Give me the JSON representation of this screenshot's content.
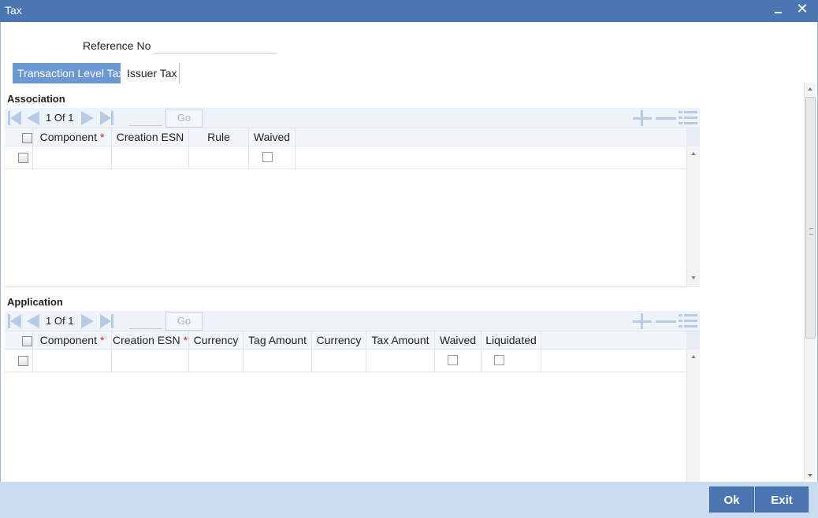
{
  "window": {
    "title": "Tax",
    "close_glyph": "✕"
  },
  "form": {
    "reference_label": "Reference No",
    "reference_value": ""
  },
  "tabs": [
    {
      "label": "Transaction Level Tax",
      "active": true
    },
    {
      "label": "Issuer Tax",
      "active": false
    }
  ],
  "association": {
    "title": "Association",
    "pager": {
      "current": "1",
      "of": "Of",
      "total": "1",
      "go_label": "Go"
    },
    "columns": [
      "Component",
      "Creation ESN",
      "Rule",
      "Waived"
    ],
    "required_marker": "*"
  },
  "application": {
    "title": "Application",
    "pager": {
      "current": "1",
      "of": "Of",
      "total": "1",
      "go_label": "Go"
    },
    "columns": [
      "Component",
      "Creation ESN",
      "Currency",
      "Tag Amount",
      "Currency",
      "Tax Amount",
      "Waived",
      "Liquidated"
    ],
    "required_marker": "*"
  },
  "footer": {
    "ok_label": "Ok",
    "exit_label": "Exit"
  },
  "colors": {
    "titlebar": "#4b76b3",
    "active_tab": "#6b98d2",
    "footer": "#c9dcef",
    "button": "#4b76b3"
  },
  "icons": [
    "minimize-icon",
    "close-icon",
    "first-page-icon",
    "prev-page-icon",
    "next-page-icon",
    "last-page-icon",
    "add-row-icon",
    "delete-row-icon",
    "single-view-icon"
  ]
}
